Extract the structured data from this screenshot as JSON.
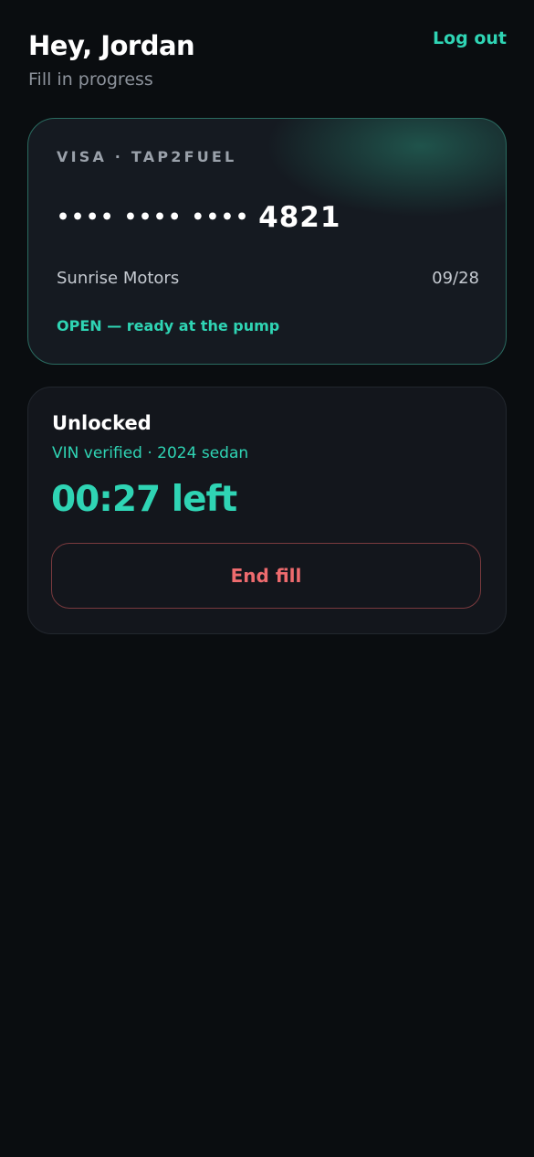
{
  "header": {
    "greeting": "Hey, Jordan",
    "subtitle": "Fill in progress",
    "logout_label": "Log out"
  },
  "card": {
    "brand": "VISA · TAP2FUEL",
    "masked_number": "•••• •••• ••••",
    "last4": "4821",
    "holder": "Sunrise Motors",
    "expiry": "09/28",
    "status": "OPEN — ready at the pump"
  },
  "session": {
    "title": "Unlocked",
    "vehicle": "VIN verified · 2024 sedan",
    "timer": "00:27 left",
    "end_label": "End fill"
  },
  "colors": {
    "background": "#0a0d10",
    "accent": "#2fd4b4",
    "danger": "#ee6b6e",
    "muted": "#8d939c"
  }
}
